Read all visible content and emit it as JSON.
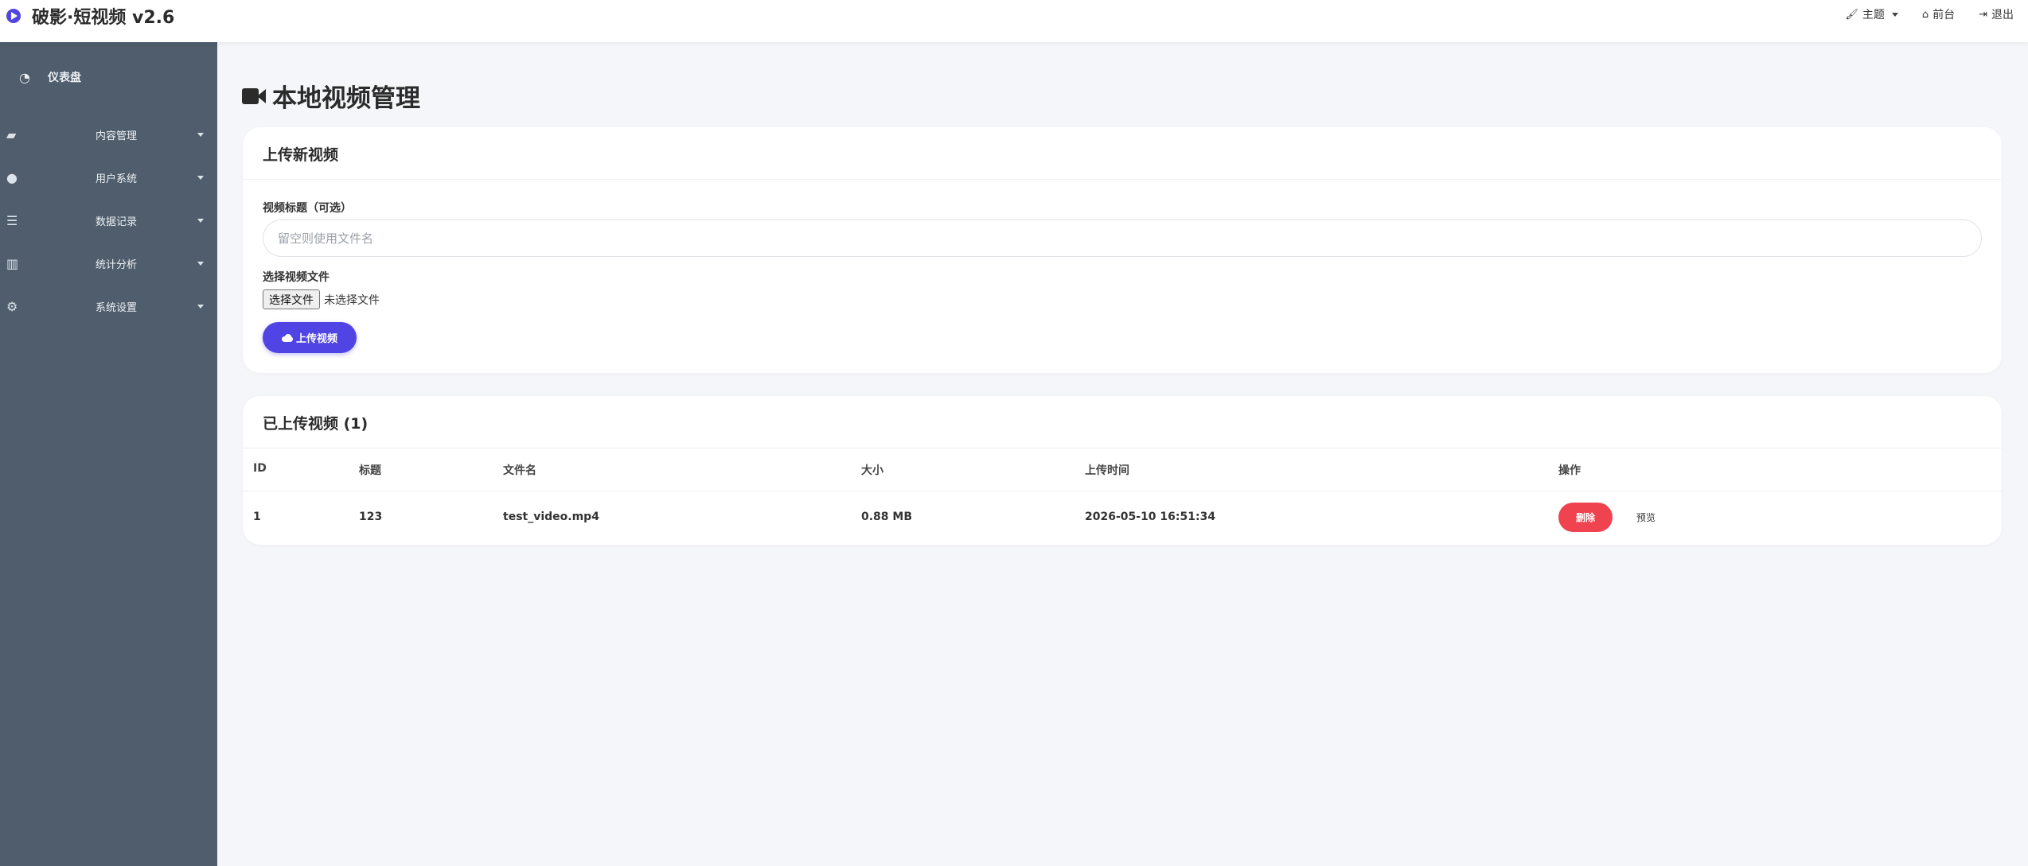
{
  "app": {
    "title": "破影·短视频 v2.6"
  },
  "topnav": {
    "theme": "主题",
    "frontend": "前台",
    "logout": "退出"
  },
  "sidebar": {
    "dashboard": "仪表盘",
    "items": [
      {
        "label": "内容管理",
        "icon": "folder-open-icon"
      },
      {
        "label": "用户系统",
        "icon": "users-icon"
      },
      {
        "label": "数据记录",
        "icon": "database-icon"
      },
      {
        "label": "统计分析",
        "icon": "bar-chart-icon"
      },
      {
        "label": "系统设置",
        "icon": "cogs-icon"
      }
    ]
  },
  "page": {
    "title": "本地视频管理"
  },
  "upload": {
    "header": "上传新视频",
    "title_label": "视频标题（可选）",
    "title_placeholder": "留空则使用文件名",
    "title_value": "",
    "file_label": "选择视频文件",
    "file_button": "选择文件",
    "file_status": "未选择文件",
    "submit": "上传视频"
  },
  "list": {
    "header": "已上传视频 (1)",
    "columns": [
      "ID",
      "标题",
      "文件名",
      "大小",
      "上传时间",
      "操作"
    ],
    "rows": [
      {
        "id": "1",
        "title": "123",
        "filename": "test_video.mp4",
        "size": "0.88 MB",
        "uploaded": "2026-05-10 16:51:34",
        "delete": "删除",
        "preview": "预览"
      }
    ]
  },
  "colors": {
    "accent": "#5044e4",
    "danger": "#ef4350",
    "sidebar": "#4f5d6c"
  }
}
